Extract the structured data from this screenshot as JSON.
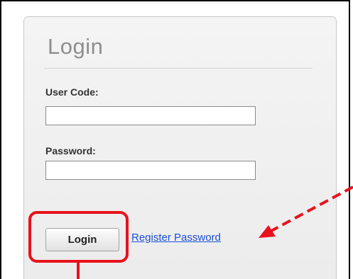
{
  "login_panel": {
    "title": "Login",
    "user_code_label": "User Code:",
    "user_code_value": "",
    "password_label": "Password:",
    "password_value": "",
    "login_button_label": "Login",
    "register_link_label": "Register Password"
  },
  "annotations": {
    "highlight_color": "#e8121c",
    "arrow_icon": "dashed-arrow-icon"
  }
}
